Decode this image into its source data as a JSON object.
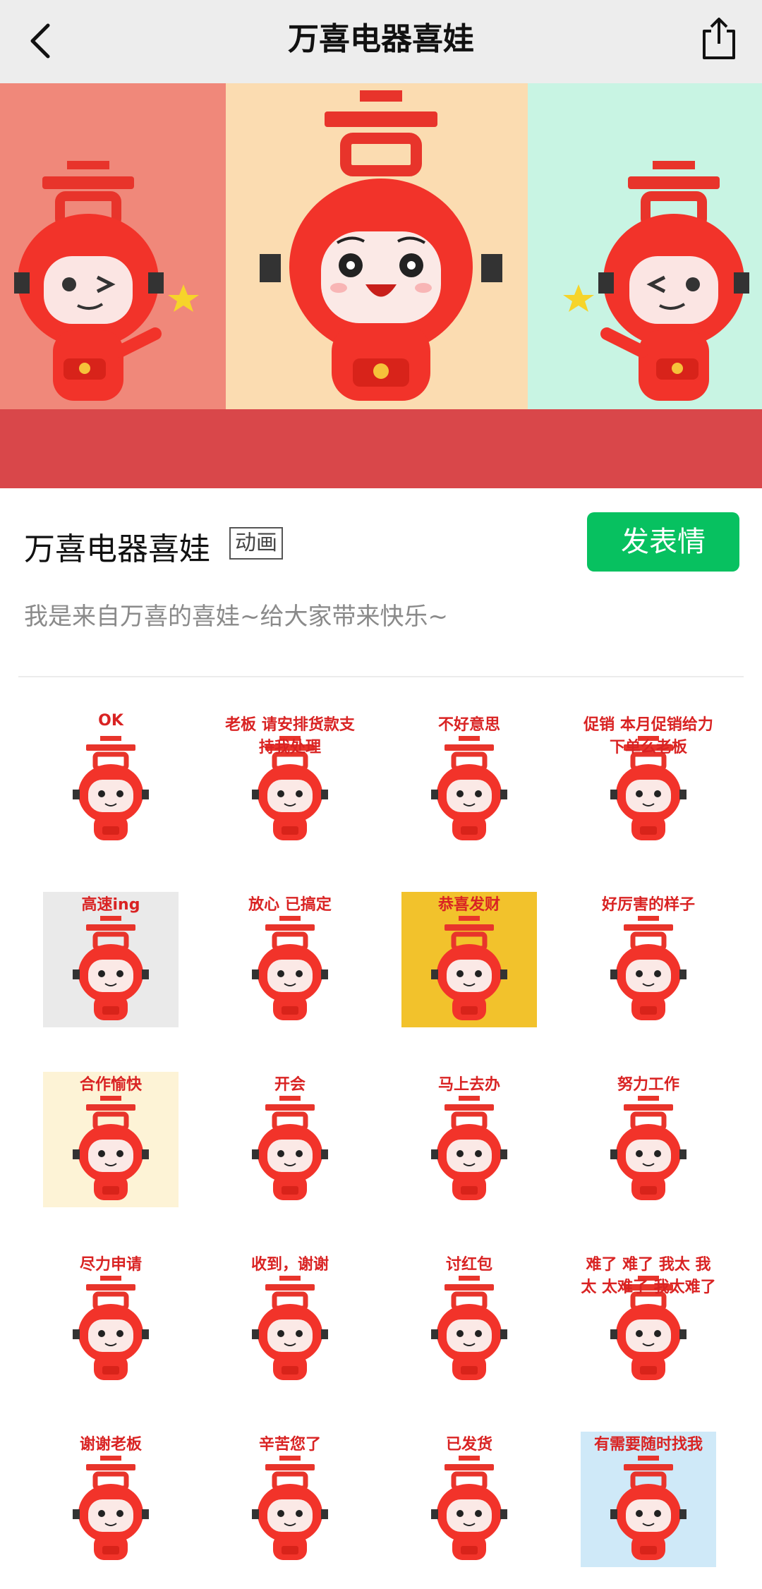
{
  "nav": {
    "title": "万喜电器喜娃",
    "back_icon": "chevron-left-icon",
    "share_icon": "share-icon"
  },
  "pack": {
    "name": "万喜电器喜娃",
    "badge": "动画",
    "send_label": "发表情",
    "description": "我是来自万喜的喜娃~给大家带来快乐~"
  },
  "colors": {
    "accent": "#07c160",
    "mascot_red": "#f2332a",
    "banner_left": "#f0887a",
    "banner_mid": "#fbdcb1",
    "banner_right": "#c8f4e3",
    "banner_floor": "#d9474a"
  },
  "stickers": [
    {
      "caption": "OK"
    },
    {
      "caption": "老板 请安排货款支持我处理"
    },
    {
      "caption": "不好意思"
    },
    {
      "caption": "促销 本月促销给力 下单么老板"
    },
    {
      "caption": "高速ing"
    },
    {
      "caption": "放心 已搞定"
    },
    {
      "caption": "恭喜发财"
    },
    {
      "caption": "好厉害的样子"
    },
    {
      "caption": "合作愉快"
    },
    {
      "caption": "开会"
    },
    {
      "caption": "马上去办"
    },
    {
      "caption": "努力工作"
    },
    {
      "caption": "尽力申请"
    },
    {
      "caption": "收到，谢谢"
    },
    {
      "caption": "讨红包"
    },
    {
      "caption": "难了 难了 我太 我太 太难了 我太难了"
    },
    {
      "caption": "谢谢老板"
    },
    {
      "caption": "辛苦您了"
    },
    {
      "caption": "已发货"
    },
    {
      "caption": "有需要随时找我"
    }
  ]
}
